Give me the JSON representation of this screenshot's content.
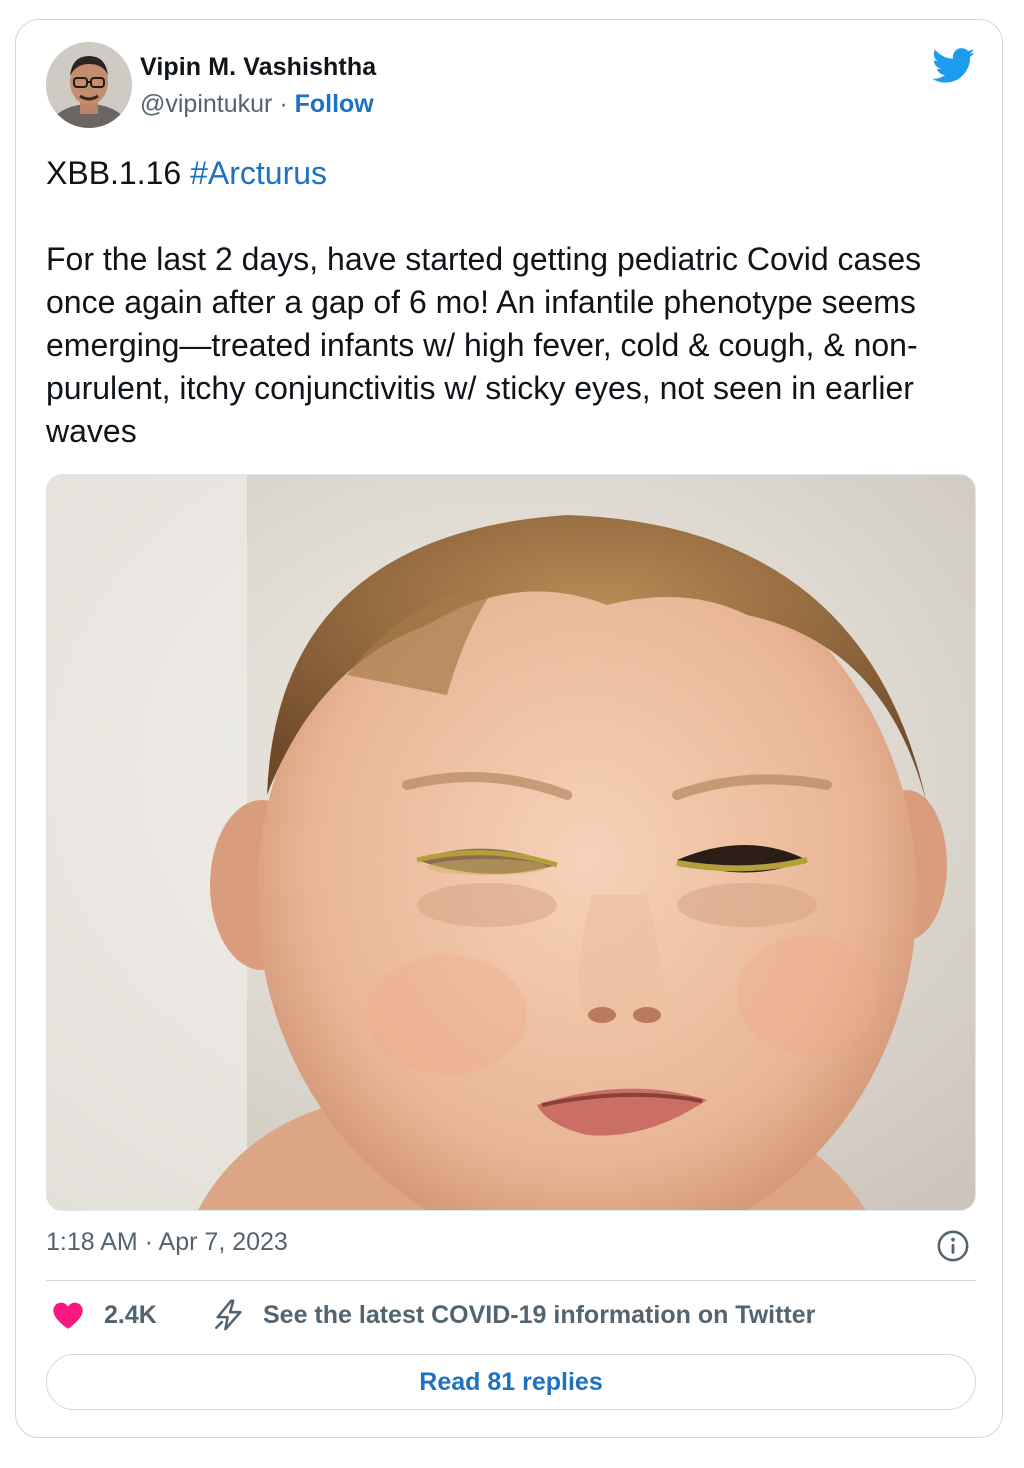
{
  "author": {
    "name": "Vipin M. Vashishtha",
    "handle": "@vipintukur",
    "separator": " · ",
    "follow_label": "Follow"
  },
  "tweet": {
    "line1_prefix": "XBB.1.16 ",
    "hashtag": "#Arcturus",
    "body": "For the last 2 days, have started getting pediatric Covid cases once again after a gap of 6 mo! An infantile phenotype seems emerging—treated infants w/ high fever, cold & cough, & non-purulent, itchy conjunctivitis w/ sticky eyes, not seen in earlier waves",
    "timestamp": "1:18 AM · Apr 7, 2023"
  },
  "actions": {
    "likes": "2.4K",
    "covid_info": "See the latest COVID-19 information on Twitter",
    "read_replies": "Read 81 replies"
  },
  "icons": {
    "brand": "twitter-bird-icon",
    "like": "heart-icon",
    "info": "info-icon",
    "covid": "lightning-icon"
  },
  "colors": {
    "link": "#1d72c2",
    "twitter_blue": "#1d9bf0",
    "like": "#f91880",
    "muted": "#536471",
    "text": "#0f1419",
    "border": "#cfd9de"
  }
}
